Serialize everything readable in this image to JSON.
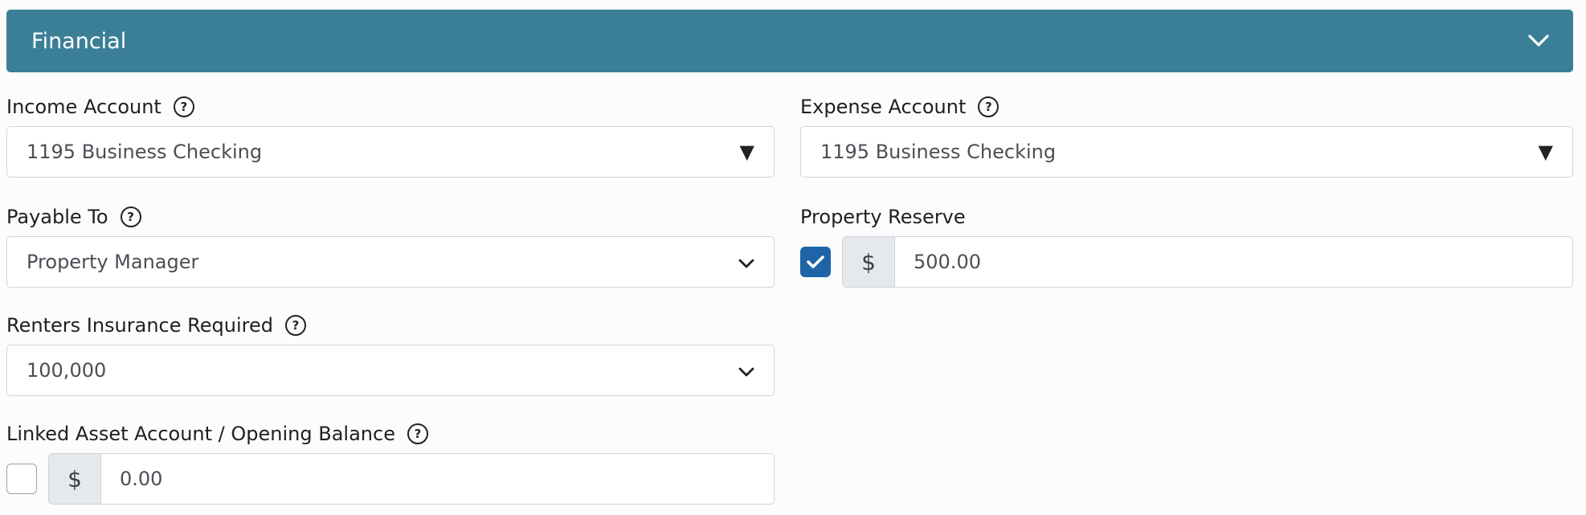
{
  "panel": {
    "title": "Financial"
  },
  "income_account": {
    "label": "Income Account",
    "value": "1195 Business Checking"
  },
  "expense_account": {
    "label": "Expense Account",
    "value": "1195 Business Checking"
  },
  "payable_to": {
    "label": "Payable To",
    "value": "Property Manager"
  },
  "property_reserve": {
    "label": "Property Reserve",
    "checked": true,
    "currency": "$",
    "value": "500.00"
  },
  "renters_insurance": {
    "label": "Renters Insurance Required",
    "value": "100,000"
  },
  "linked_asset": {
    "label": "Linked Asset Account / Opening Balance",
    "checked": false,
    "currency": "$",
    "value": "0.00"
  },
  "icons": {
    "help": "question-circle-icon",
    "collapse": "chevron-down-icon",
    "select_arrow": "triangle-down-icon",
    "check": "check-icon"
  },
  "colors": {
    "header_bg": "#3b7f97",
    "checkbox_checked": "#1e64a6",
    "addon_bg": "#e5e8ec",
    "border": "#cfd4da"
  }
}
